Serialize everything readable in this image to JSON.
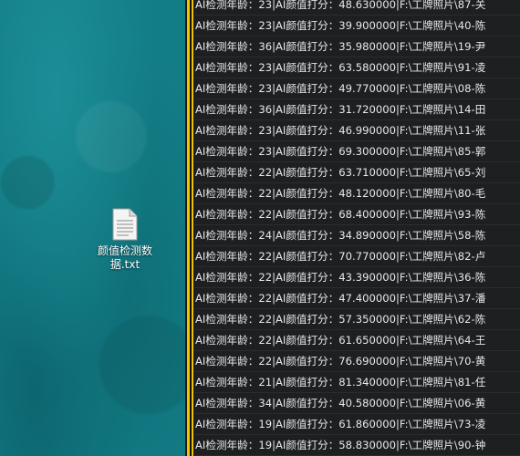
{
  "desktop": {
    "file": {
      "name": "颜值检测数据.txt",
      "icon": "text-file-icon"
    }
  },
  "console": {
    "lines": [
      "AI检测年龄：23|AI颜值打分：48.630000|F:\\工牌照片\\87-关",
      "AI检测年龄：23|AI颜值打分：39.900000|F:\\工牌照片\\40-陈",
      "AI检测年龄：36|AI颜值打分：35.980000|F:\\工牌照片\\19-尹",
      "AI检测年龄：23|AI颜值打分：63.580000|F:\\工牌照片\\91-凌",
      "AI检测年龄：23|AI颜值打分：49.770000|F:\\工牌照片\\08-陈",
      "AI检测年龄：36|AI颜值打分：31.720000|F:\\工牌照片\\14-田",
      "AI检测年龄：23|AI颜值打分：46.990000|F:\\工牌照片\\11-张",
      "AI检测年龄：23|AI颜值打分：69.300000|F:\\工牌照片\\85-郭",
      "AI检测年龄：22|AI颜值打分：63.710000|F:\\工牌照片\\65-刘",
      "AI检测年龄：22|AI颜值打分：48.120000|F:\\工牌照片\\80-毛",
      "AI检测年龄：22|AI颜值打分：68.400000|F:\\工牌照片\\93-陈",
      "AI检测年龄：24|AI颜值打分：34.890000|F:\\工牌照片\\58-陈",
      "AI检测年龄：22|AI颜值打分：70.770000|F:\\工牌照片\\82-卢",
      "AI检测年龄：22|AI颜值打分：43.390000|F:\\工牌照片\\36-陈",
      "AI检测年龄：22|AI颜值打分：47.400000|F:\\工牌照片\\37-潘",
      "AI检测年龄：22|AI颜值打分：57.350000|F:\\工牌照片\\62-陈",
      "AI检测年龄：22|AI颜值打分：61.650000|F:\\工牌照片\\64-王",
      "AI检测年龄：22|AI颜值打分：76.690000|F:\\工牌照片\\70-黄",
      "AI检测年龄：21|AI颜值打分：81.340000|F:\\工牌照片\\81-任",
      "AI检测年龄：34|AI颜值打分：40.580000|F:\\工牌照片\\06-黄",
      "AI检测年龄：19|AI颜值打分：61.860000|F:\\工牌照片\\73-凌",
      "AI检测年龄：19|AI颜值打分：58.830000|F:\\工牌照片\\90-钟"
    ],
    "text_color": "#e8e8e8",
    "background_color": "#1d1f21"
  }
}
